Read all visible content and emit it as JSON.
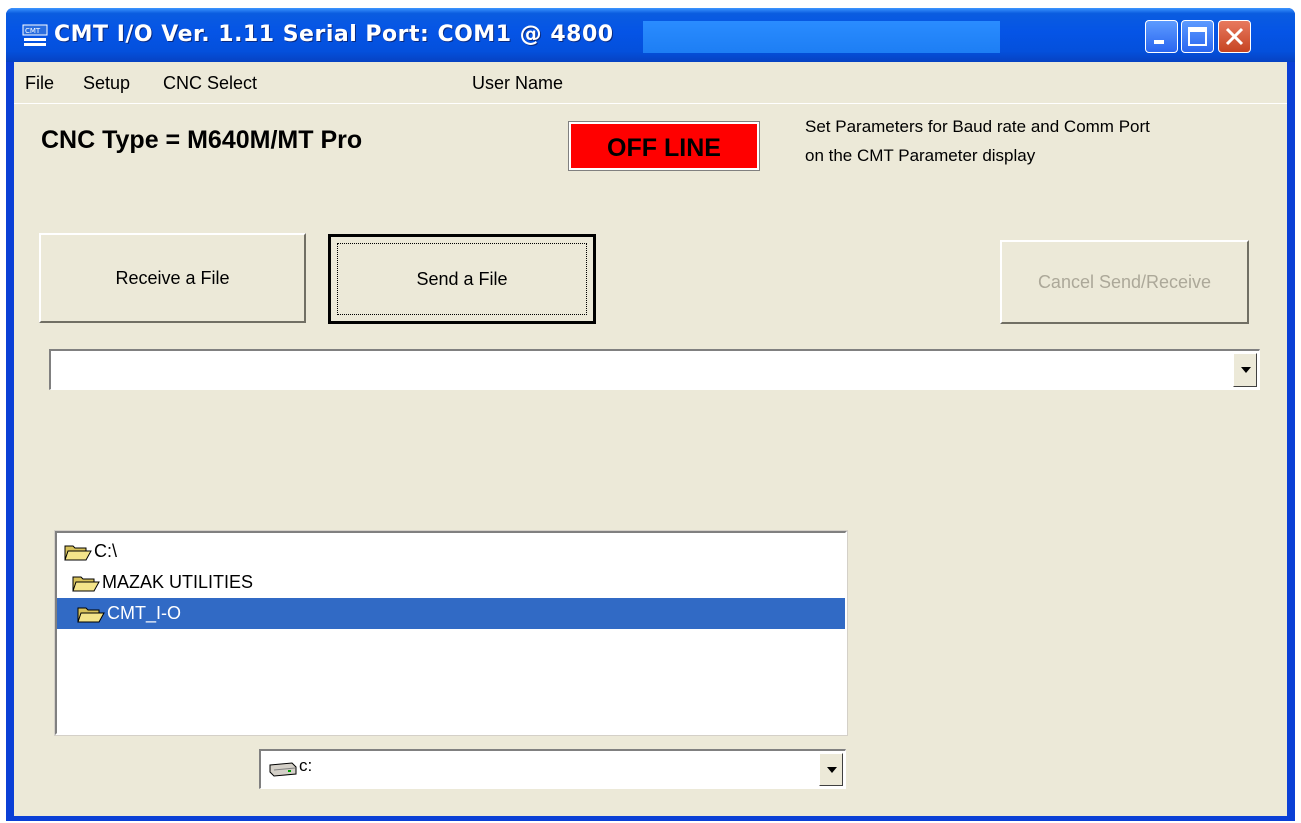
{
  "window": {
    "title": "CMT I/O  Ver. 1.11  Serial Port: COM1 @ 4800",
    "controls": [
      "minimize-icon",
      "maximize-icon",
      "close-icon"
    ]
  },
  "menu": {
    "file": "File",
    "setup": "Setup",
    "cnc_select": "CNC Select",
    "user_name": "User Name"
  },
  "status": {
    "cnc_type": "CNC Type = M640M/MT Pro",
    "connection": "OFF LINE",
    "hint_line1": "Set Parameters for Baud rate and Comm Port",
    "hint_line2": "on the CMT Parameter display"
  },
  "buttons": {
    "receive": "Receive a File",
    "send": "Send a File",
    "cancel": "Cancel Send/Receive"
  },
  "file_combo": {
    "value": ""
  },
  "directories": {
    "items": [
      {
        "label": "C:\\",
        "selected": false
      },
      {
        "label": "MAZAK UTILITIES",
        "selected": false
      },
      {
        "label": "CMT_I-O",
        "selected": true
      }
    ]
  },
  "drive": {
    "value": "c:"
  },
  "colors": {
    "titlebar": "#0554e6",
    "window_face": "#ece9d8",
    "offline_bg": "#ff0000",
    "selection": "#316ac5",
    "disabled_text": "#aca899"
  }
}
